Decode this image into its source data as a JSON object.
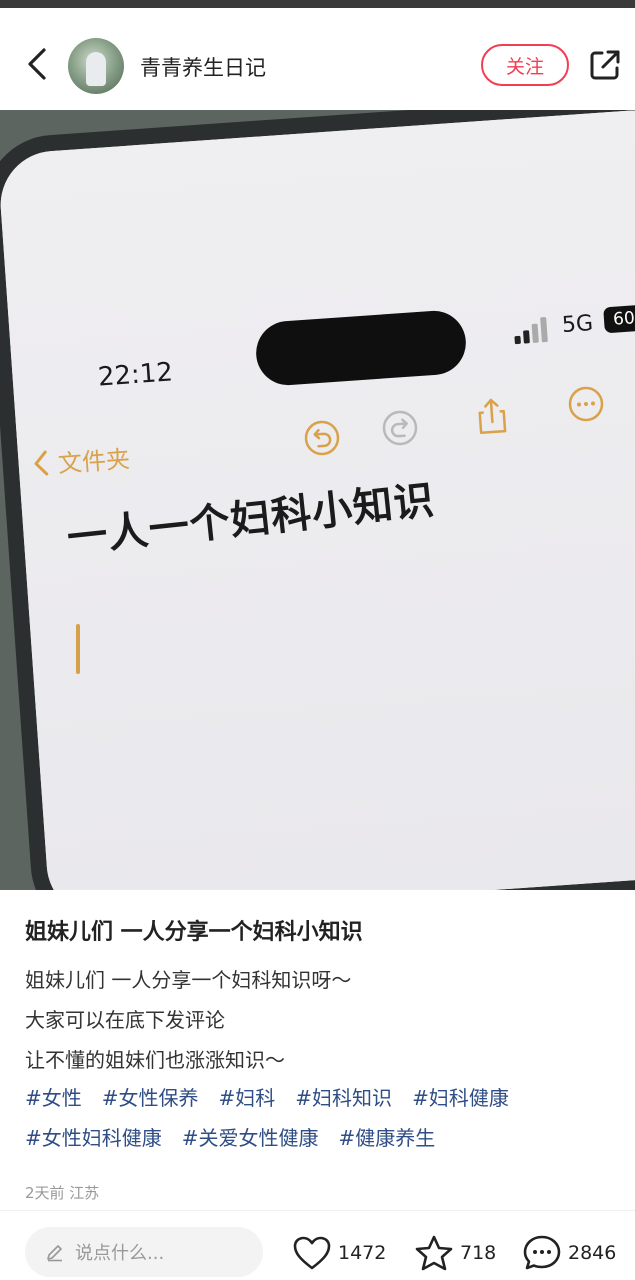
{
  "header": {
    "author_name": "青青养生日记",
    "follow_label": "关注"
  },
  "photo": {
    "phone_time": "22:12",
    "network": "5G",
    "battery": "60",
    "folder_label": "文件夹",
    "note_title": "一人一个妇科小知识"
  },
  "post": {
    "title": "姐妹儿们 一人分享一个妇科小知识",
    "body_lines": [
      "姐妹儿们 一人分享一个妇科知识呀～",
      "大家可以在底下发评论",
      "让不懂的姐妹们也涨涨知识～"
    ],
    "tags": [
      "#女性",
      "#女性保养",
      "#妇科",
      "#妇科知识",
      "#妇科健康",
      "#女性妇科健康",
      "#关爱女性健康",
      "#健康养生"
    ],
    "meta": "2天前 江苏"
  },
  "bottom_bar": {
    "comment_placeholder": "说点什么...",
    "like_count": "1472",
    "collect_count": "718",
    "comment_count": "2846"
  },
  "colors": {
    "accent": "#f23d53",
    "tag": "#2f4e85",
    "notes_accent": "#d9a24a"
  }
}
